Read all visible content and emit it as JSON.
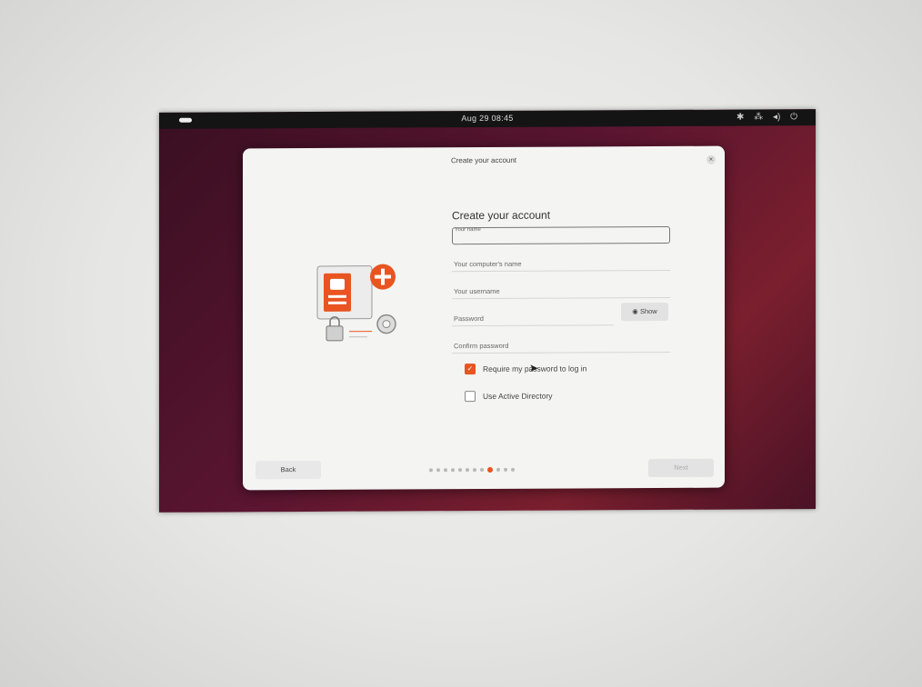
{
  "topbar": {
    "clock": "Aug 29 08:45",
    "tray_icons": [
      "accessibility-icon",
      "network-icon",
      "volume-icon",
      "power-icon"
    ]
  },
  "dialog": {
    "title": "Create your account",
    "close_icon": "×",
    "heading": "Create your account",
    "fields": {
      "name_label": "Your name",
      "computer_name_label": "Your computer's name",
      "username_label": "Your username",
      "password_label": "Password",
      "confirm_label": "Confirm password"
    },
    "show_label": "Show",
    "require_password": {
      "label": "Require my password to log in",
      "checked": true
    },
    "active_directory": {
      "label": "Use Active Directory",
      "checked": false
    },
    "back_label": "Back",
    "next_label": "Next",
    "steps": {
      "total": 12,
      "current": 9
    }
  },
  "colors": {
    "accent": "#e95420",
    "wallpaper": "#5a1530"
  }
}
